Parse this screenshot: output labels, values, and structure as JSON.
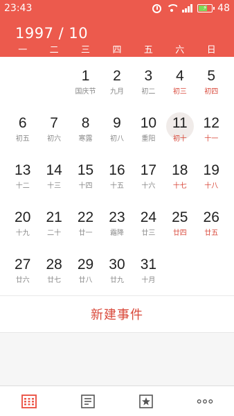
{
  "status_bar": {
    "time": "23:43",
    "battery": "48",
    "icons": [
      "alarm-icon",
      "wifi-icon",
      "signal-icon",
      "battery-icon"
    ]
  },
  "header": {
    "month_title": "1997 / 10",
    "weekdays": [
      "一",
      "二",
      "三",
      "四",
      "五",
      "六",
      "日"
    ]
  },
  "calendar": {
    "weeks": [
      [
        {
          "num": "",
          "lunar": ""
        },
        {
          "num": "",
          "lunar": ""
        },
        {
          "num": "1",
          "lunar": "国庆节"
        },
        {
          "num": "2",
          "lunar": "九月"
        },
        {
          "num": "3",
          "lunar": "初二"
        },
        {
          "num": "4",
          "lunar": "初三"
        },
        {
          "num": "5",
          "lunar": "初四"
        }
      ],
      [
        {
          "num": "6",
          "lunar": "初五"
        },
        {
          "num": "7",
          "lunar": "初六"
        },
        {
          "num": "8",
          "lunar": "寒露"
        },
        {
          "num": "9",
          "lunar": "初八"
        },
        {
          "num": "10",
          "lunar": "重阳"
        },
        {
          "num": "11",
          "lunar": "初十"
        },
        {
          "num": "12",
          "lunar": "十一"
        }
      ],
      [
        {
          "num": "13",
          "lunar": "十二"
        },
        {
          "num": "14",
          "lunar": "十三"
        },
        {
          "num": "15",
          "lunar": "十四"
        },
        {
          "num": "16",
          "lunar": "十五"
        },
        {
          "num": "17",
          "lunar": "十六"
        },
        {
          "num": "18",
          "lunar": "十七"
        },
        {
          "num": "19",
          "lunar": "十八"
        }
      ],
      [
        {
          "num": "20",
          "lunar": "十九"
        },
        {
          "num": "21",
          "lunar": "二十"
        },
        {
          "num": "22",
          "lunar": "廿一"
        },
        {
          "num": "23",
          "lunar": "霜降"
        },
        {
          "num": "24",
          "lunar": "廿三"
        },
        {
          "num": "25",
          "lunar": "廿四"
        },
        {
          "num": "26",
          "lunar": "廿五"
        }
      ],
      [
        {
          "num": "27",
          "lunar": "廿六"
        },
        {
          "num": "28",
          "lunar": "廿七"
        },
        {
          "num": "29",
          "lunar": "廿八"
        },
        {
          "num": "30",
          "lunar": "廿九"
        },
        {
          "num": "31",
          "lunar": "十月"
        },
        {
          "num": "",
          "lunar": ""
        },
        {
          "num": "",
          "lunar": ""
        }
      ]
    ],
    "selected_day": "11"
  },
  "new_event_label": "新建事件",
  "bottom_tabs": [
    "calendar-grid-icon",
    "list-icon",
    "star-icon",
    "more-icon"
  ],
  "colors": {
    "accent": "#ec5a4d",
    "weekend_lunar": "#d9493b",
    "today_circle": "#f0ebe9",
    "active_tab": "#ec5a4d"
  }
}
